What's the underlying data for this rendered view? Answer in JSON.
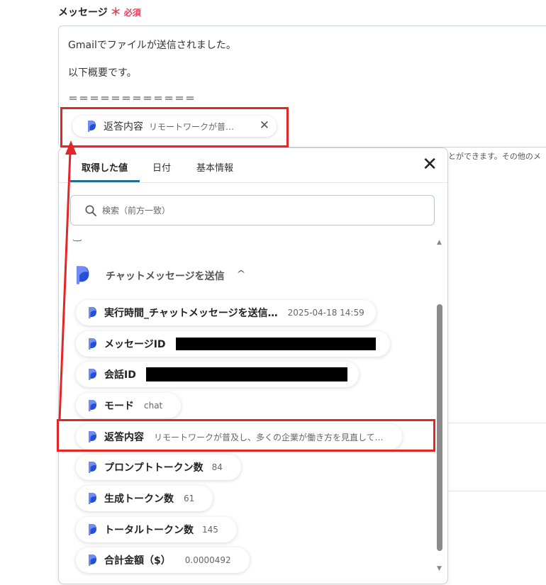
{
  "field": {
    "label": "メッセージ",
    "required_mark": "＊",
    "required_text": "必須"
  },
  "editor": {
    "line1": "Gmailでファイルが送信されました。",
    "line2": "以下概要です。",
    "line3": "＝＝＝＝＝＝＝＝＝＝＝＝",
    "chip": {
      "label": "返答内容",
      "value": "リモートワークが普…"
    }
  },
  "helper_text": "とができます。その他のメ",
  "panel": {
    "tabs": [
      {
        "label": "取得した値"
      },
      {
        "label": "日付"
      },
      {
        "label": "基本情報"
      }
    ],
    "search_placeholder": "検索（前方一致）",
    "section_title": "チャットメッセージを送信",
    "items": [
      {
        "label": "実行時間_チャットメッセージを送信…",
        "value": "2025-04-18 14:59"
      },
      {
        "label": "メッセージID",
        "value": ""
      },
      {
        "label": "会話ID",
        "value": ""
      },
      {
        "label": "モード",
        "value": "chat"
      },
      {
        "label": "返答内容",
        "value": "リモートワークが普及し、多くの企業が働き方を見直して…"
      },
      {
        "label": "プロンプトトークン数",
        "value": "84"
      },
      {
        "label": "生成トークン数",
        "value": "61"
      },
      {
        "label": "トータルトークン数",
        "value": "145"
      },
      {
        "label": "合計金額（$）",
        "value": "0.0000492"
      }
    ]
  },
  "colors": {
    "accent": "#1f6f8b",
    "highlight": "#e32626",
    "required": "#e0455a"
  }
}
